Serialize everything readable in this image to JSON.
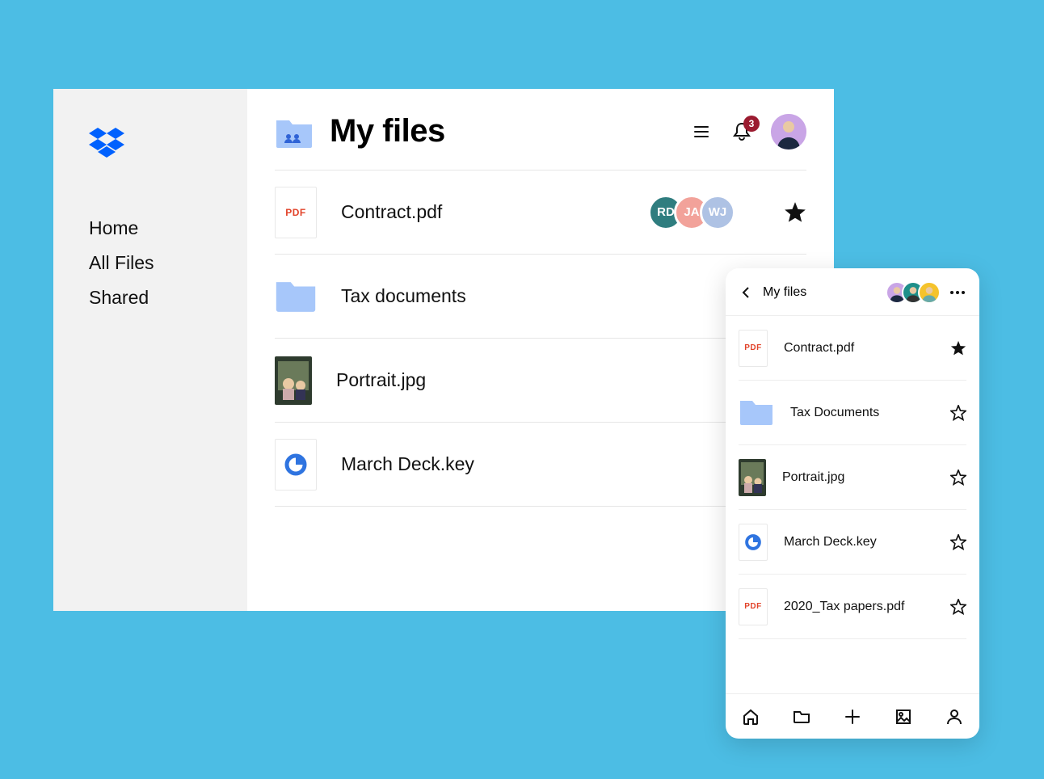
{
  "sidebar": {
    "items": [
      {
        "label": "Home"
      },
      {
        "label": "All Files"
      },
      {
        "label": "Shared"
      }
    ]
  },
  "header": {
    "title": "My files",
    "notification_count": "3"
  },
  "shared_with": [
    {
      "initials": "RD",
      "color": "#2f7d7f"
    },
    {
      "initials": "JA",
      "color": "#f2a29a"
    },
    {
      "initials": "WJ",
      "color": "#aec2e4"
    }
  ],
  "files": [
    {
      "name": "Contract.pdf",
      "type": "pdf",
      "starred": true,
      "badge": "PDF"
    },
    {
      "name": "Tax documents",
      "type": "folder",
      "starred": false
    },
    {
      "name": "Portrait.jpg",
      "type": "photo",
      "starred": false
    },
    {
      "name": "March Deck.key",
      "type": "key",
      "starred": false
    }
  ],
  "mobile": {
    "title": "My files",
    "avatars": [
      {
        "color": "#c9a5e6"
      },
      {
        "color": "#1f8f8a"
      },
      {
        "color": "#f5c32c"
      }
    ],
    "files": [
      {
        "name": "Contract.pdf",
        "type": "pdf",
        "starred": true,
        "badge": "PDF"
      },
      {
        "name": "Tax Documents",
        "type": "folder",
        "starred": false
      },
      {
        "name": "Portrait.jpg",
        "type": "photo",
        "starred": false
      },
      {
        "name": "March Deck.key",
        "type": "key",
        "starred": false
      },
      {
        "name": "2020_Tax papers.pdf",
        "type": "pdf",
        "starred": false,
        "badge": "PDF"
      }
    ]
  }
}
